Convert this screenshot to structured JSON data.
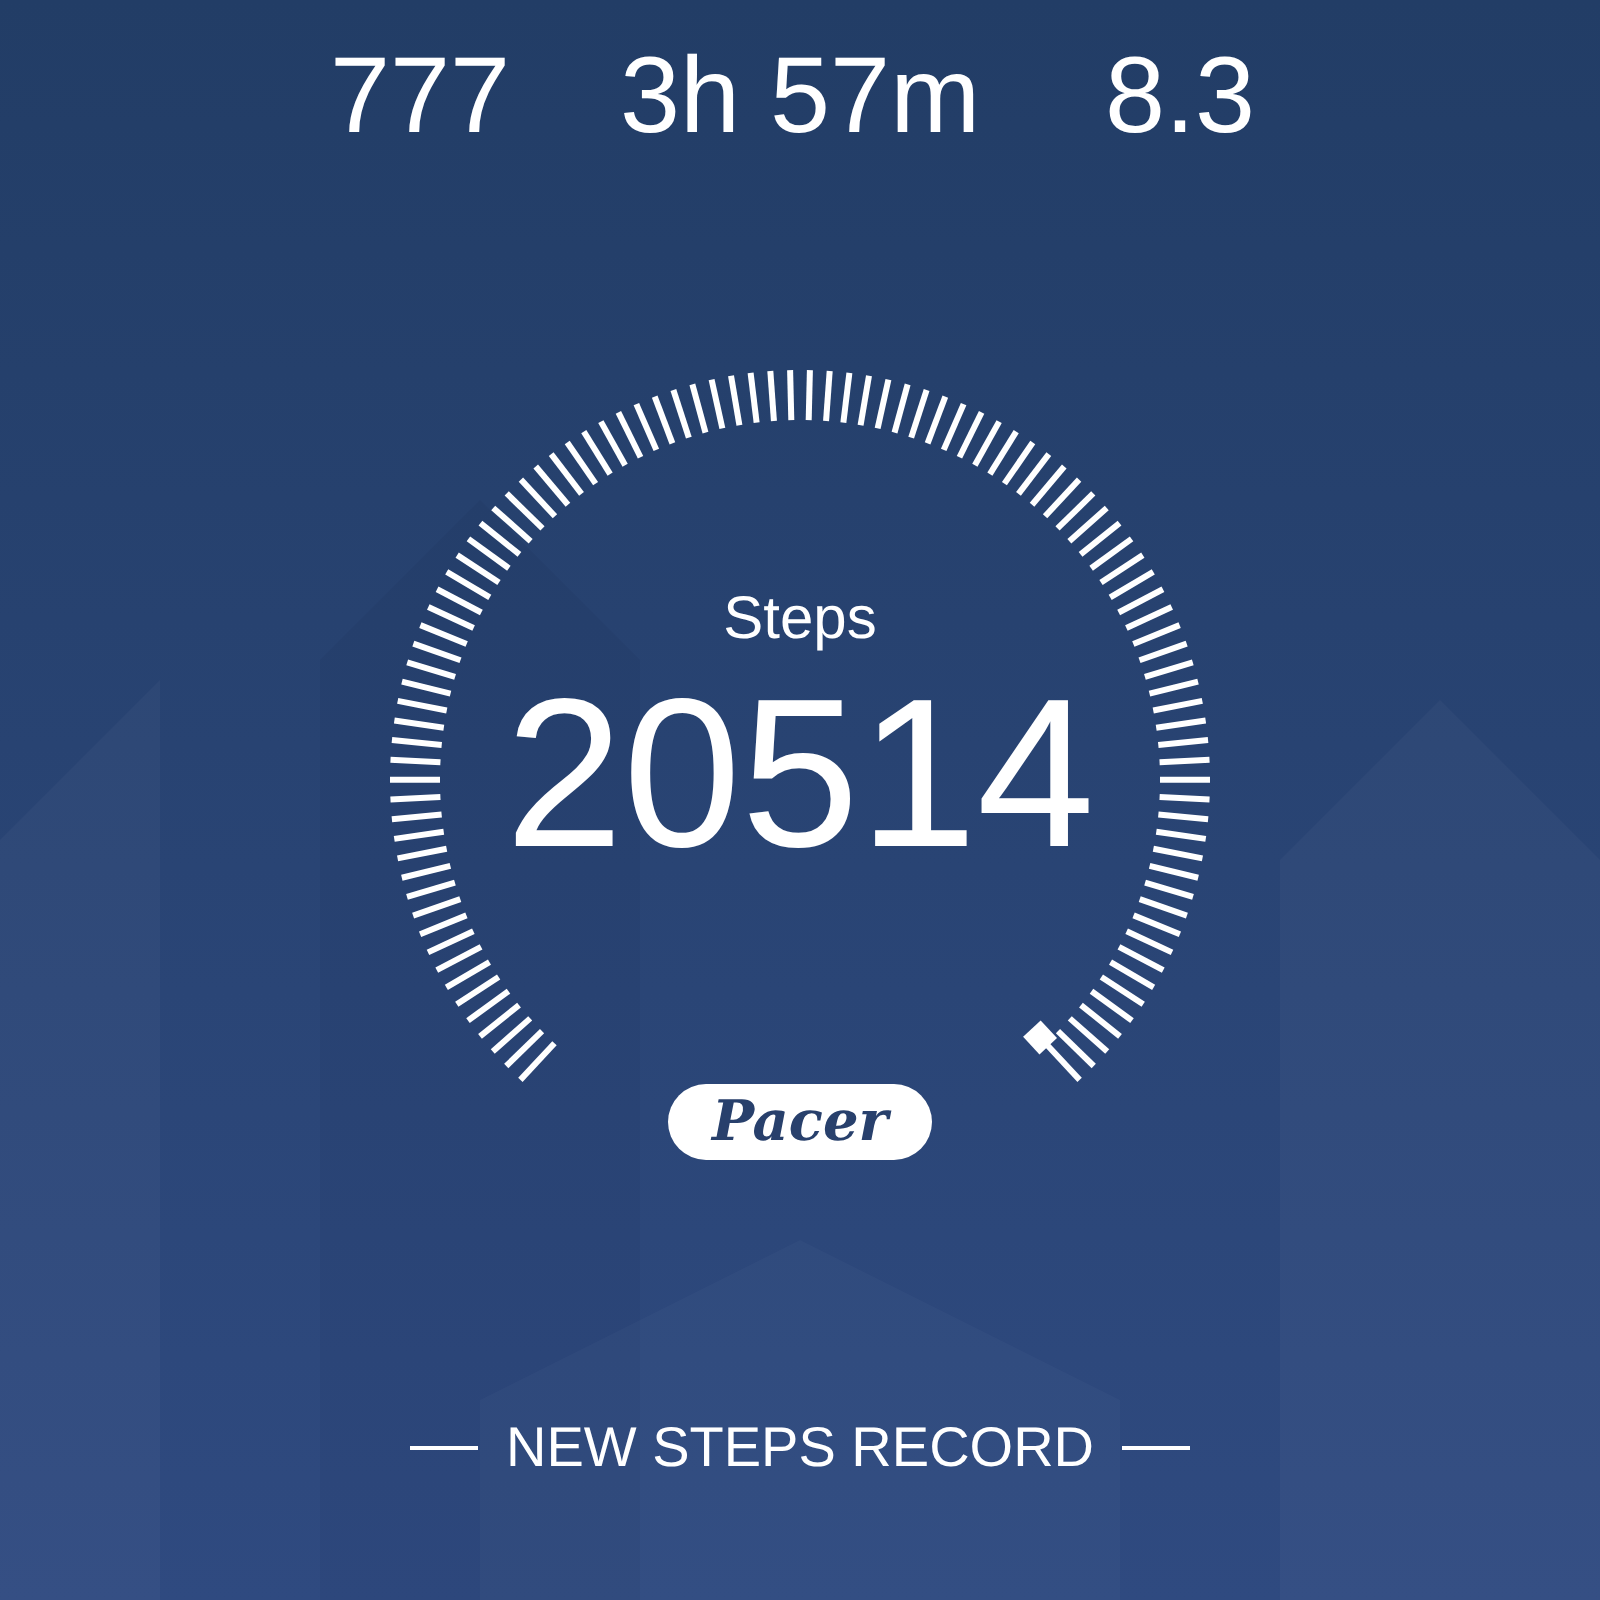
{
  "stats": [
    {
      "value": "777"
    },
    {
      "value": "3h 57m"
    },
    {
      "value": "8.3"
    }
  ],
  "gauge": {
    "label": "Steps",
    "value": "20514"
  },
  "logo": "Pacer",
  "banner": "NEW STEPS RECORD"
}
